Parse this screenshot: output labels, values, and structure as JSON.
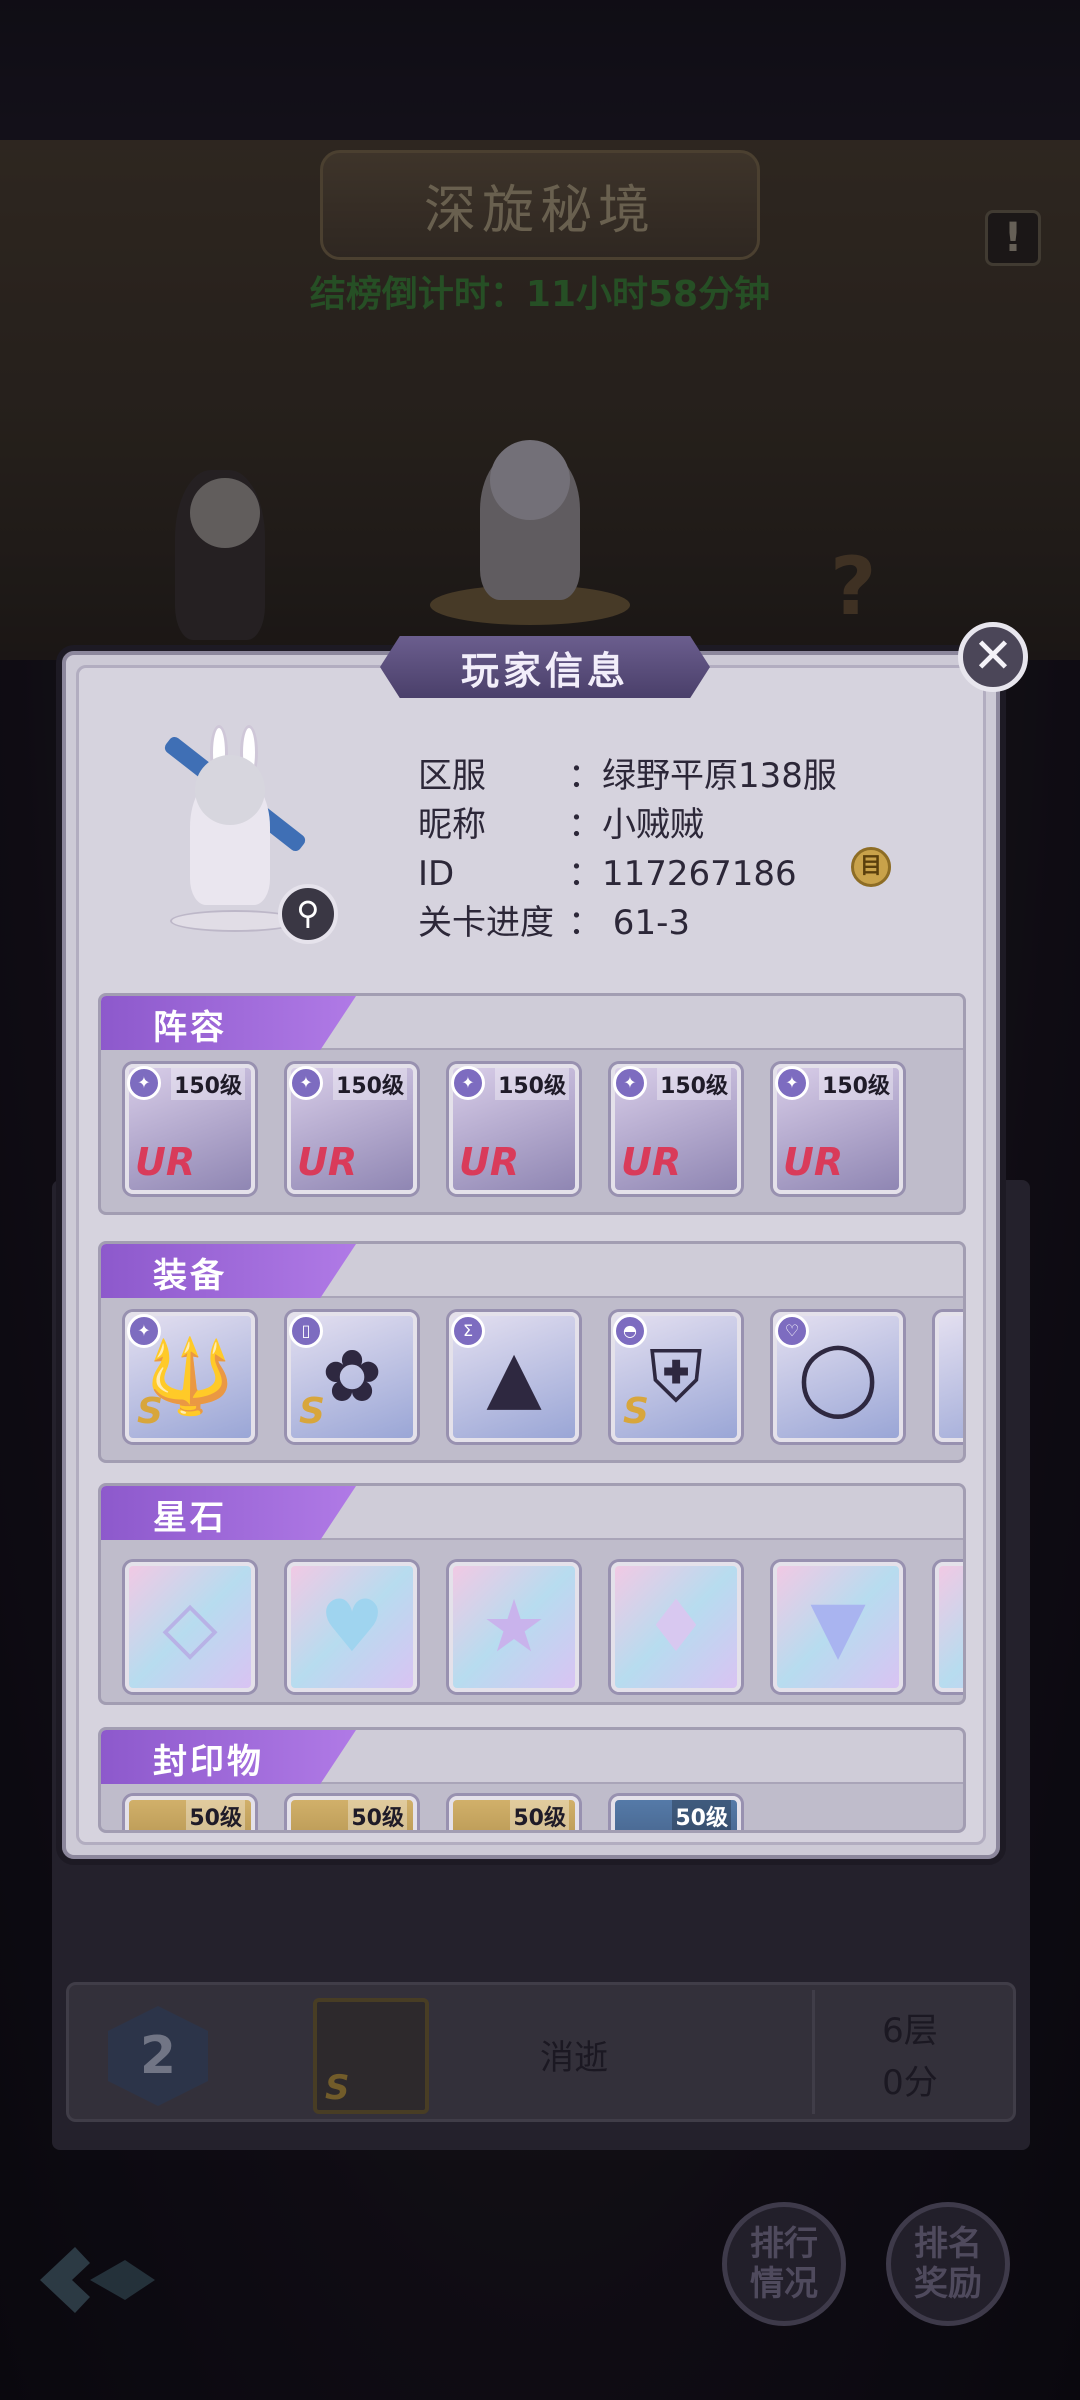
{
  "game": {
    "title": "深旋秘境",
    "countdown": "结榜倒计时：11小时58分钟",
    "info_icon": "exclamation-icon",
    "help_icon": "question-icon"
  },
  "ranking": {
    "rank": "2",
    "player_name": "消逝",
    "floor": "6层",
    "score": "0分",
    "avatar_grade": "S",
    "buttons": {
      "rank_status": "排行\n情况",
      "rank_reward": "排名\n奖励"
    }
  },
  "modal": {
    "title": "玩家信息",
    "close_icon": "close-icon",
    "info": {
      "server_label": "区服",
      "server_value": "：绿野平原138服",
      "nickname_label": "昵称",
      "nickname_value": "：小贼贼",
      "id_label": "ID",
      "id_value": "：117267186",
      "stage_label": "关卡进度",
      "stage_value": "：  61-3"
    },
    "sections": {
      "lineup": {
        "label": "阵容",
        "heroes": [
          {
            "level": "150级",
            "grade": "UR"
          },
          {
            "level": "150级",
            "grade": "UR"
          },
          {
            "level": "150级",
            "grade": "UR"
          },
          {
            "level": "150级",
            "grade": "UR"
          },
          {
            "level": "150级",
            "grade": "UR"
          }
        ]
      },
      "equipment": {
        "label": "装备",
        "items": [
          {
            "icon": "trident-icon",
            "grade": "S"
          },
          {
            "icon": "lotus-book-icon",
            "grade": "S"
          },
          {
            "icon": "witch-hat-icon",
            "grade": ""
          },
          {
            "icon": "armor-icon",
            "grade": "S"
          },
          {
            "icon": "bracelet-icon",
            "grade": ""
          }
        ]
      },
      "starstones": {
        "label": "星石",
        "items": [
          {
            "icon": "square-gem-icon"
          },
          {
            "icon": "heart-gem-icon"
          },
          {
            "icon": "star-gem-icon"
          },
          {
            "icon": "diamond-gem-icon"
          },
          {
            "icon": "triangle-gem-icon"
          }
        ]
      },
      "seals": {
        "label": "封印物",
        "items": [
          {
            "level": "50级"
          },
          {
            "level": "50级"
          },
          {
            "level": "50级"
          },
          {
            "level": "50级"
          }
        ]
      }
    }
  },
  "colors": {
    "accent_purple": "#a06ad9",
    "ur_red": "#d93b5a",
    "s_gold": "#d8a63c",
    "countdown_green": "#3f8a3a"
  }
}
